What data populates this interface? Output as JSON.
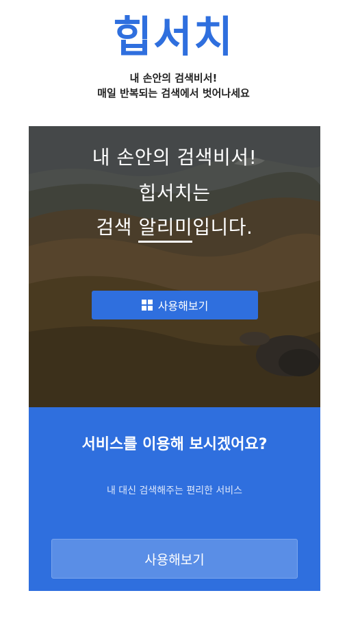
{
  "brand": {
    "logo": "힙서치",
    "tagline_line1": "내 손안의 검색비서!",
    "tagline_line2": "매일 반복되는 검색에서 벗어나세요"
  },
  "hero": {
    "line1": "내 손안의 검색비서!",
    "line2_brand": "힙서치",
    "line2_suffix": "는",
    "line3_prefix": "검색 ",
    "line3_emphasis": "알리미",
    "line3_suffix": "입니다.",
    "cta_label": "사용해보기",
    "cta_icon": "windows-grid-icon"
  },
  "service": {
    "title": "서비스를 이용해 보시겠어요?",
    "subtitle": "내 대신 검색해주는 편리한 서비스",
    "cta_label": "사용해보기"
  },
  "colors": {
    "brand_blue": "#2f6fde",
    "button_light_blue": "#5a8ee6"
  }
}
